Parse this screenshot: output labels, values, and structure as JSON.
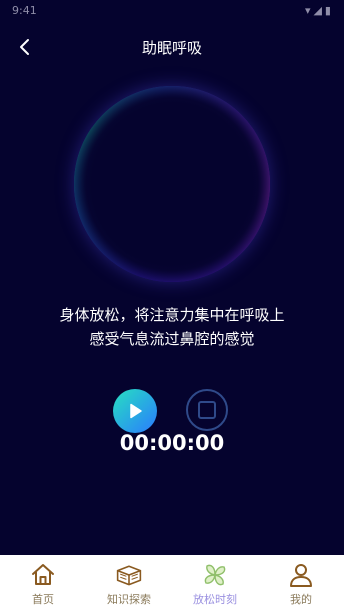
{
  "status_bar": {
    "time": "9:41",
    "icons": "▾◢▮"
  },
  "header": {
    "title": "助眠呼吸"
  },
  "instruction": {
    "line1": "身体放松，将注意力集中在呼吸上",
    "line2": "感受气息流过鼻腔的感觉"
  },
  "timer": "00:00:00",
  "tab_bar": {
    "items": [
      {
        "label": "首页",
        "icon": "home-icon"
      },
      {
        "label": "知识探索",
        "icon": "books-icon"
      },
      {
        "label": "放松时刻",
        "icon": "pinwheel-icon"
      },
      {
        "label": "我的",
        "icon": "user-icon"
      }
    ],
    "active_index": 2
  },
  "colors": {
    "background": "#05032e",
    "accent_gradient_start": "#27e0c0",
    "accent_gradient_end": "#2a7bff",
    "tab_inactive": "#8a7a5a",
    "tab_active": "#9a90e0"
  }
}
